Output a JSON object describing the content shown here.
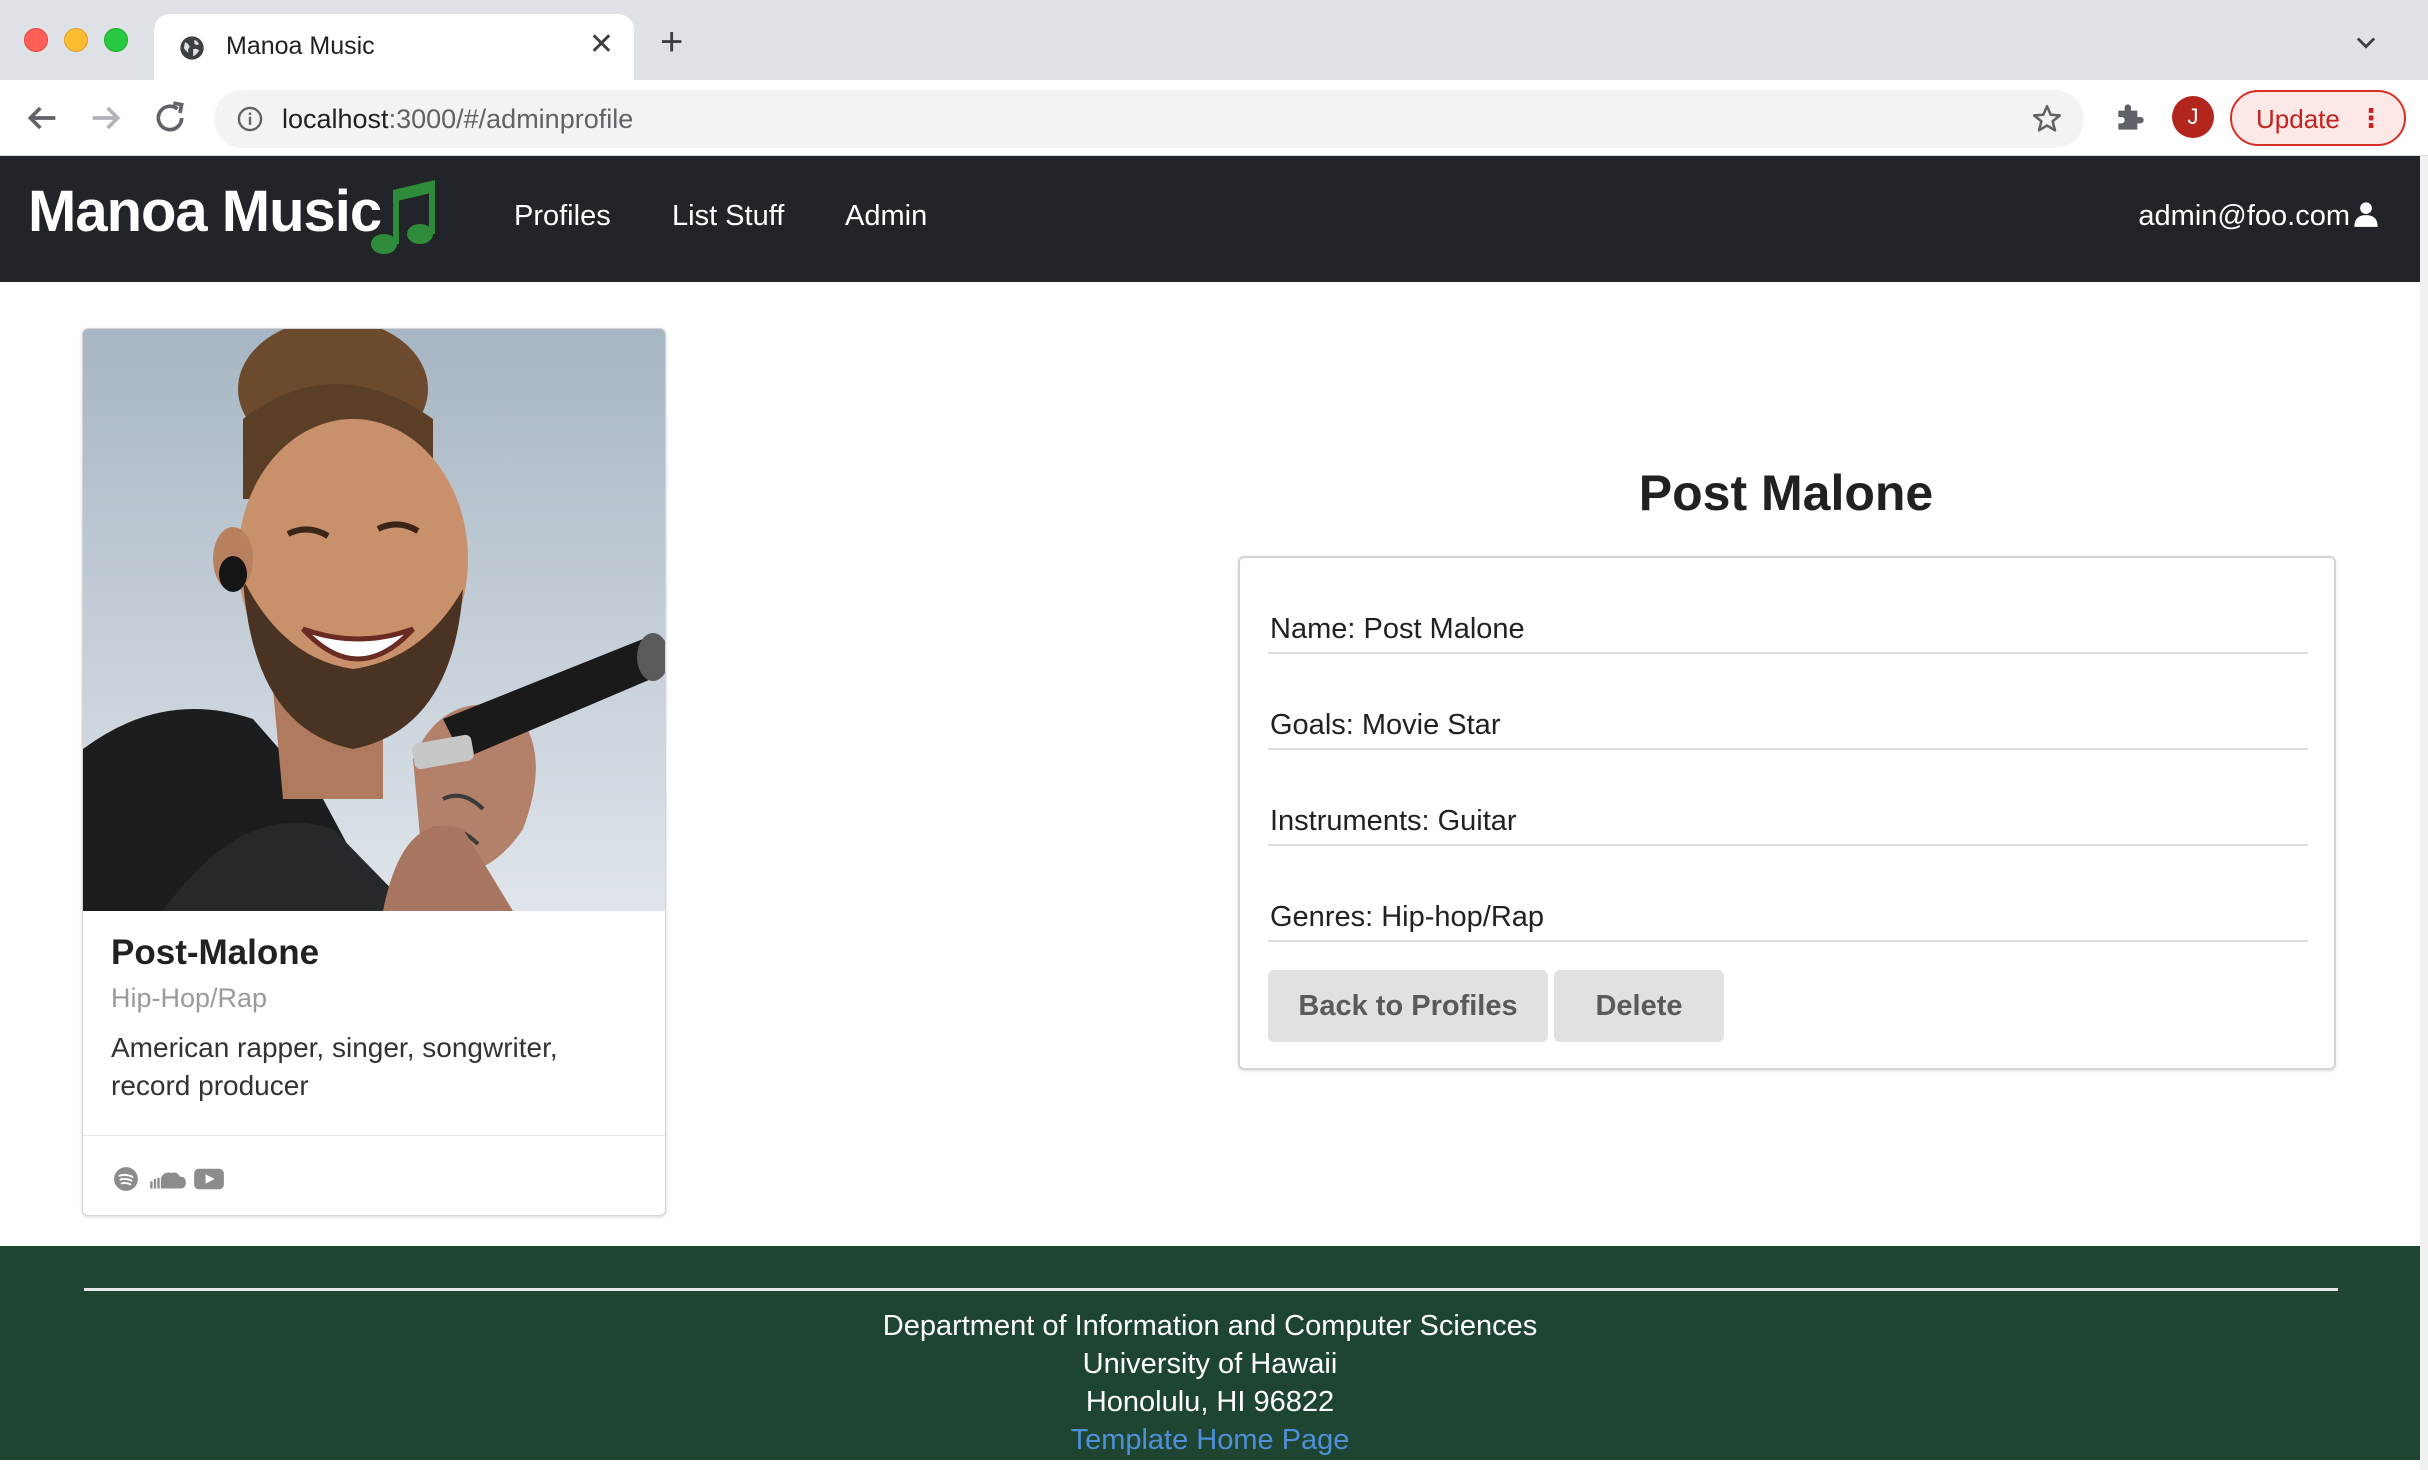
{
  "browser": {
    "tab_title": "Manoa Music",
    "url_host": "localhost",
    "url_rest": ":3000/#/adminprofile",
    "avatar_letter": "J",
    "update_label": "Update",
    "icons": [
      "globe-icon",
      "close-icon",
      "plus-icon",
      "chevron-down-icon",
      "back-arrow-icon",
      "forward-arrow-icon",
      "reload-icon",
      "info-icon",
      "star-icon",
      "puzzle-icon",
      "kebab-menu-icon"
    ]
  },
  "navbar": {
    "brand": "Manoa Music",
    "brand_icon": "music-note-icon",
    "links": [
      "Profiles",
      "List Stuff",
      "Admin"
    ],
    "user": "admin@foo.com",
    "user_icon": "user-icon",
    "background": "#212529",
    "accent": "#2e8b3a"
  },
  "card": {
    "name": "Post-Malone",
    "meta": "Hip-Hop/Rap",
    "description": "American rapper, singer, songwriter, record producer",
    "social_icons": [
      "spotify-icon",
      "soundcloud-icon",
      "youtube-icon"
    ]
  },
  "detail": {
    "title": "Post Malone",
    "fields": [
      "Name: Post Malone",
      "Goals: Movie Star",
      "Instruments: Guitar",
      "Genres: Hip-hop/Rap"
    ],
    "buttons": {
      "back": "Back to Profiles",
      "delete": "Delete"
    }
  },
  "footer": {
    "lines": [
      "Department of Information and Computer Sciences",
      "University of Hawaii",
      "Honolulu, HI 96822"
    ],
    "link": "Template Home Page",
    "background": "#1e4532",
    "link_color": "#4f8fd8"
  }
}
